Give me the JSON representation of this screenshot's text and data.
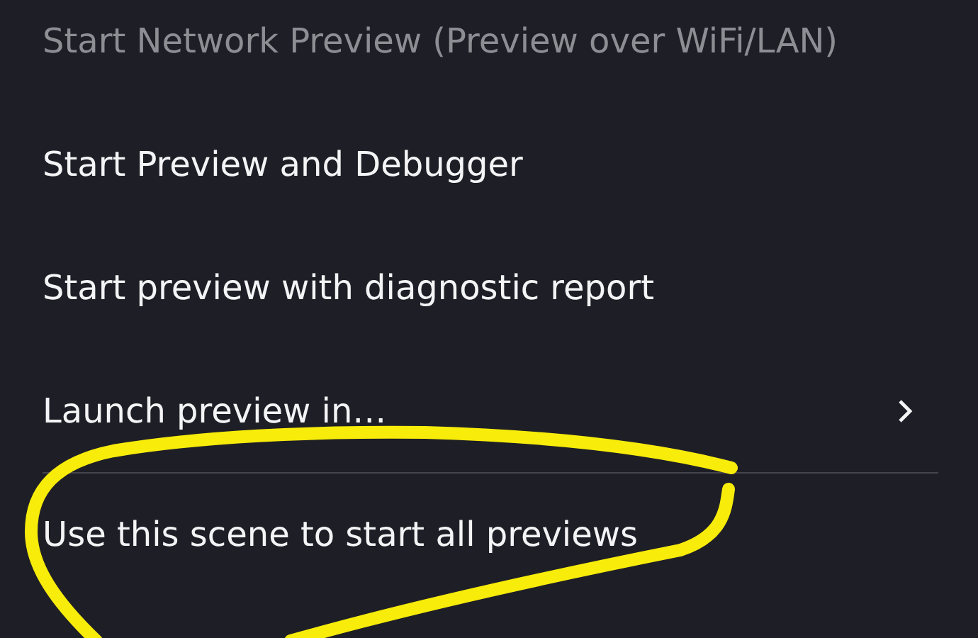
{
  "menu": {
    "items": [
      {
        "kind": "action",
        "label": "Start Network Preview (Preview over WiFi/LAN)",
        "disabled": true,
        "divider_before": false
      },
      {
        "kind": "action",
        "label": "Start Preview and Debugger",
        "disabled": false,
        "divider_before": false
      },
      {
        "kind": "action",
        "label": "Start preview with diagnostic report",
        "disabled": false,
        "divider_before": false
      },
      {
        "kind": "submenu",
        "label": "Launch preview in…",
        "disabled": false,
        "divider_before": false
      },
      {
        "kind": "action",
        "label": "Use this scene to start all previews",
        "disabled": false,
        "divider_before": true
      }
    ]
  }
}
